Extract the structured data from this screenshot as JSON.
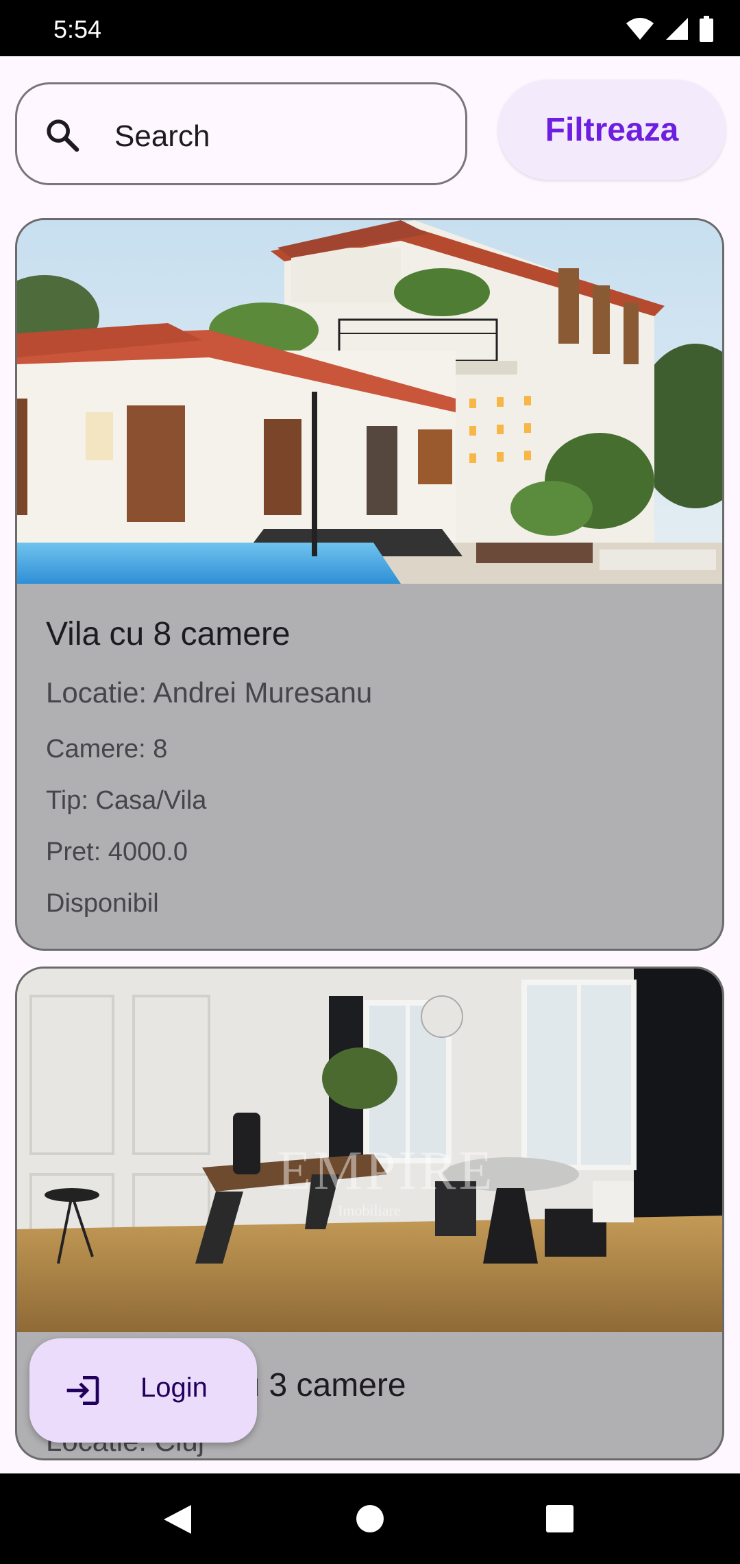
{
  "status_bar": {
    "time": "5:54"
  },
  "search": {
    "placeholder": "Search"
  },
  "filter_button": {
    "label": "Filtreaza"
  },
  "listings": [
    {
      "title": "Vila cu 8 camere",
      "location": "Locatie: Andrei Muresanu",
      "rooms": "Camere: 8",
      "type": "Tip: Casa/Vila",
      "price": "Pret: 4000.0",
      "availability": "Disponibil"
    },
    {
      "title": "Apartament cu 3 camere",
      "location": "Locatie: Cluj",
      "watermark_brand": "EMPIRE",
      "watermark_sub": "Imobiliare"
    }
  ],
  "login_button": {
    "label": "Login"
  },
  "icons": {
    "search": "search-icon",
    "login": "login-icon",
    "wifi": "wifi-icon",
    "signal": "signal-icon",
    "battery": "battery-icon",
    "back": "back-icon",
    "home": "home-icon",
    "recents": "recents-icon"
  },
  "colors": {
    "background": "#fef7ff",
    "card": "#b0afb2",
    "accent": "#6d1ee0",
    "fab": "#ecdcfb"
  }
}
